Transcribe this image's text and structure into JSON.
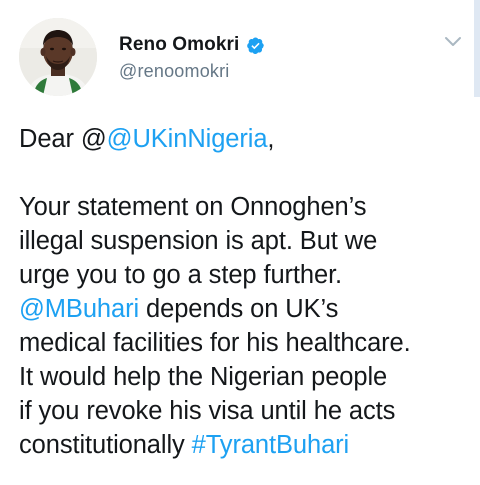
{
  "author": {
    "display_name": "Reno Omokri",
    "handle": "@renoomokri",
    "verified": true
  },
  "icons": {
    "verified": "verified-badge-icon",
    "menu": "chevron-down-icon"
  },
  "colors": {
    "link": "#1da1f2",
    "text": "#14171a",
    "secondary": "#657786",
    "verified": "#1da1f2"
  },
  "tweet": {
    "greeting_prefix": "Dear @",
    "greeting_mention": "@UKinNigeria",
    "greeting_suffix": ",",
    "line1": "Your statement on Onnoghen’s",
    "line2": "illegal suspension is apt. But we",
    "line3": "urge you to go a step further.",
    "line4_mention": "@MBuhari",
    "line4_rest": " depends on UK’s",
    "line5": "medical facilities for his healthcare.",
    "line6": "It would help the Nigerian people",
    "line7": "if you revoke his visa until he acts",
    "line8_text": "constitutionally ",
    "line8_hashtag": "#TyrantBuhari"
  }
}
